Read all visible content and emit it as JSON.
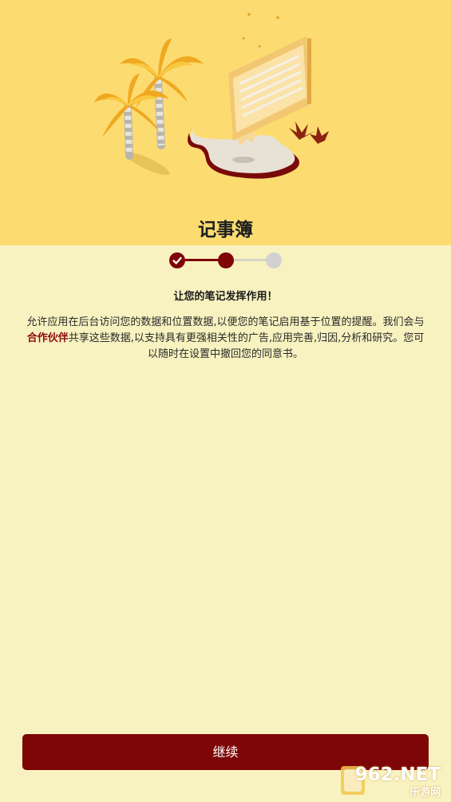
{
  "header": {
    "title": "记事簿"
  },
  "stepper": {
    "total_steps": 3,
    "current_step": 2,
    "completed_steps": 1
  },
  "content": {
    "headline": "让您的笔记发挥作用！",
    "body_before": "允许应用在后台访问您的数据和位置数据,以便您的笔记启用基于位置的提醒。我们会与",
    "partner_link": "合作伙伴",
    "body_after": "共享这些数据,以支持具有更强相关性的广告,应用完善,归因,分析和研究。您可以随时在设置中撤回您的同意书。"
  },
  "footer": {
    "continue_label": "继续"
  },
  "watermark": {
    "main": "962.NET",
    "sub": "乐游网"
  },
  "colors": {
    "hero_bg": "#fcdc70",
    "page_bg": "#f8f2c0",
    "accent": "#7e0607",
    "step_inactive": "#d3d0d2"
  },
  "icons": {
    "completed_step": "check-icon"
  }
}
